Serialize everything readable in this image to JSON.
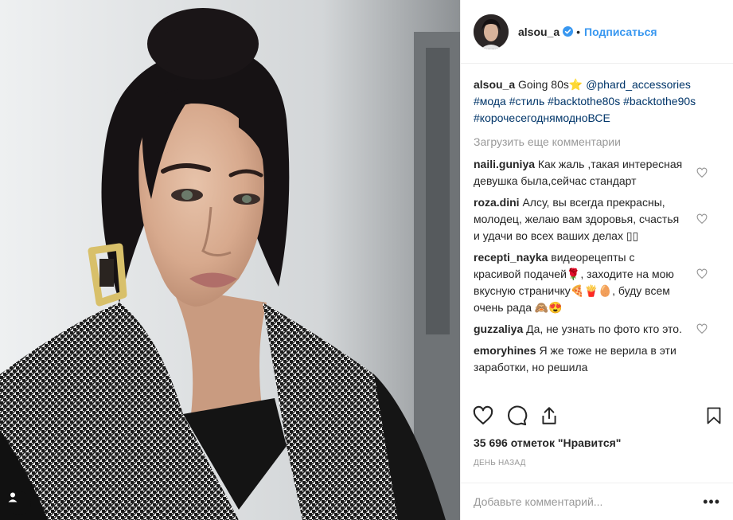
{
  "header": {
    "username": "alsou_a",
    "separator": "•",
    "follow_label": "Подписаться"
  },
  "caption": {
    "username": "alsou_a",
    "text": "Going 80s",
    "emoji": "⭐",
    "mention": "@phard_accessories",
    "hashtags": [
      "#мода",
      "#стиль",
      "#backtothe80s",
      "#backtothe90s",
      "#корочесегоднямодноВСЕ"
    ]
  },
  "load_more_label": "Загрузить еще комментарии",
  "comments": [
    {
      "username": "naili.guniya",
      "text": "Как жаль ,такая интересная девушка была,сейчас стандарт"
    },
    {
      "username": "roza.dini",
      "text": "Алсу, вы всегда прекрасны, молодец, желаю вам здоровья, счастья и удачи во всех ваших делах ▯▯"
    },
    {
      "username": "recepti_nayka",
      "text": "видеорецепты с красивой подачей🌹, заходите на мою вкусную страничку🍕🍟🥚, буду всем очень рада 🙈😍"
    },
    {
      "username": "guzzaliya",
      "text": "Да, не узнать по фото кто это."
    },
    {
      "username": "emoryhines",
      "text": "Я же тоже не верила в эти заработки, но решила"
    }
  ],
  "likes_label": "35 696 отметок \"Нравится\"",
  "time_label": "ДЕНЬ НАЗАД",
  "add_comment_placeholder": "Добавьте комментарий...",
  "more_label": "•••",
  "icons": {
    "verified": "verified-badge-icon",
    "like": "heart-icon",
    "comment": "comment-bubble-icon",
    "share": "share-icon",
    "save": "bookmark-icon",
    "tag": "person-tag-icon"
  },
  "colors": {
    "accent": "#3897f0",
    "link": "#003569",
    "muted": "#999999",
    "text": "#262626",
    "border": "#efefef"
  }
}
